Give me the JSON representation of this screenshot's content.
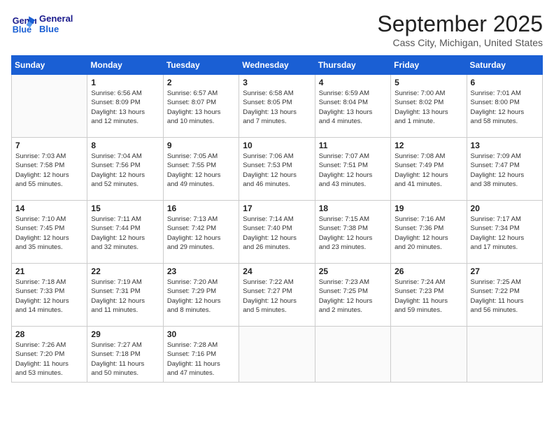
{
  "header": {
    "logo_line1": "General",
    "logo_line2": "Blue",
    "month": "September 2025",
    "location": "Cass City, Michigan, United States"
  },
  "weekdays": [
    "Sunday",
    "Monday",
    "Tuesday",
    "Wednesday",
    "Thursday",
    "Friday",
    "Saturday"
  ],
  "weeks": [
    [
      {
        "day": "",
        "info": ""
      },
      {
        "day": "1",
        "info": "Sunrise: 6:56 AM\nSunset: 8:09 PM\nDaylight: 13 hours\nand 12 minutes."
      },
      {
        "day": "2",
        "info": "Sunrise: 6:57 AM\nSunset: 8:07 PM\nDaylight: 13 hours\nand 10 minutes."
      },
      {
        "day": "3",
        "info": "Sunrise: 6:58 AM\nSunset: 8:05 PM\nDaylight: 13 hours\nand 7 minutes."
      },
      {
        "day": "4",
        "info": "Sunrise: 6:59 AM\nSunset: 8:04 PM\nDaylight: 13 hours\nand 4 minutes."
      },
      {
        "day": "5",
        "info": "Sunrise: 7:00 AM\nSunset: 8:02 PM\nDaylight: 13 hours\nand 1 minute."
      },
      {
        "day": "6",
        "info": "Sunrise: 7:01 AM\nSunset: 8:00 PM\nDaylight: 12 hours\nand 58 minutes."
      }
    ],
    [
      {
        "day": "7",
        "info": "Sunrise: 7:03 AM\nSunset: 7:58 PM\nDaylight: 12 hours\nand 55 minutes."
      },
      {
        "day": "8",
        "info": "Sunrise: 7:04 AM\nSunset: 7:56 PM\nDaylight: 12 hours\nand 52 minutes."
      },
      {
        "day": "9",
        "info": "Sunrise: 7:05 AM\nSunset: 7:55 PM\nDaylight: 12 hours\nand 49 minutes."
      },
      {
        "day": "10",
        "info": "Sunrise: 7:06 AM\nSunset: 7:53 PM\nDaylight: 12 hours\nand 46 minutes."
      },
      {
        "day": "11",
        "info": "Sunrise: 7:07 AM\nSunset: 7:51 PM\nDaylight: 12 hours\nand 43 minutes."
      },
      {
        "day": "12",
        "info": "Sunrise: 7:08 AM\nSunset: 7:49 PM\nDaylight: 12 hours\nand 41 minutes."
      },
      {
        "day": "13",
        "info": "Sunrise: 7:09 AM\nSunset: 7:47 PM\nDaylight: 12 hours\nand 38 minutes."
      }
    ],
    [
      {
        "day": "14",
        "info": "Sunrise: 7:10 AM\nSunset: 7:45 PM\nDaylight: 12 hours\nand 35 minutes."
      },
      {
        "day": "15",
        "info": "Sunrise: 7:11 AM\nSunset: 7:44 PM\nDaylight: 12 hours\nand 32 minutes."
      },
      {
        "day": "16",
        "info": "Sunrise: 7:13 AM\nSunset: 7:42 PM\nDaylight: 12 hours\nand 29 minutes."
      },
      {
        "day": "17",
        "info": "Sunrise: 7:14 AM\nSunset: 7:40 PM\nDaylight: 12 hours\nand 26 minutes."
      },
      {
        "day": "18",
        "info": "Sunrise: 7:15 AM\nSunset: 7:38 PM\nDaylight: 12 hours\nand 23 minutes."
      },
      {
        "day": "19",
        "info": "Sunrise: 7:16 AM\nSunset: 7:36 PM\nDaylight: 12 hours\nand 20 minutes."
      },
      {
        "day": "20",
        "info": "Sunrise: 7:17 AM\nSunset: 7:34 PM\nDaylight: 12 hours\nand 17 minutes."
      }
    ],
    [
      {
        "day": "21",
        "info": "Sunrise: 7:18 AM\nSunset: 7:33 PM\nDaylight: 12 hours\nand 14 minutes."
      },
      {
        "day": "22",
        "info": "Sunrise: 7:19 AM\nSunset: 7:31 PM\nDaylight: 12 hours\nand 11 minutes."
      },
      {
        "day": "23",
        "info": "Sunrise: 7:20 AM\nSunset: 7:29 PM\nDaylight: 12 hours\nand 8 minutes."
      },
      {
        "day": "24",
        "info": "Sunrise: 7:22 AM\nSunset: 7:27 PM\nDaylight: 12 hours\nand 5 minutes."
      },
      {
        "day": "25",
        "info": "Sunrise: 7:23 AM\nSunset: 7:25 PM\nDaylight: 12 hours\nand 2 minutes."
      },
      {
        "day": "26",
        "info": "Sunrise: 7:24 AM\nSunset: 7:23 PM\nDaylight: 11 hours\nand 59 minutes."
      },
      {
        "day": "27",
        "info": "Sunrise: 7:25 AM\nSunset: 7:22 PM\nDaylight: 11 hours\nand 56 minutes."
      }
    ],
    [
      {
        "day": "28",
        "info": "Sunrise: 7:26 AM\nSunset: 7:20 PM\nDaylight: 11 hours\nand 53 minutes."
      },
      {
        "day": "29",
        "info": "Sunrise: 7:27 AM\nSunset: 7:18 PM\nDaylight: 11 hours\nand 50 minutes."
      },
      {
        "day": "30",
        "info": "Sunrise: 7:28 AM\nSunset: 7:16 PM\nDaylight: 11 hours\nand 47 minutes."
      },
      {
        "day": "",
        "info": ""
      },
      {
        "day": "",
        "info": ""
      },
      {
        "day": "",
        "info": ""
      },
      {
        "day": "",
        "info": ""
      }
    ]
  ]
}
